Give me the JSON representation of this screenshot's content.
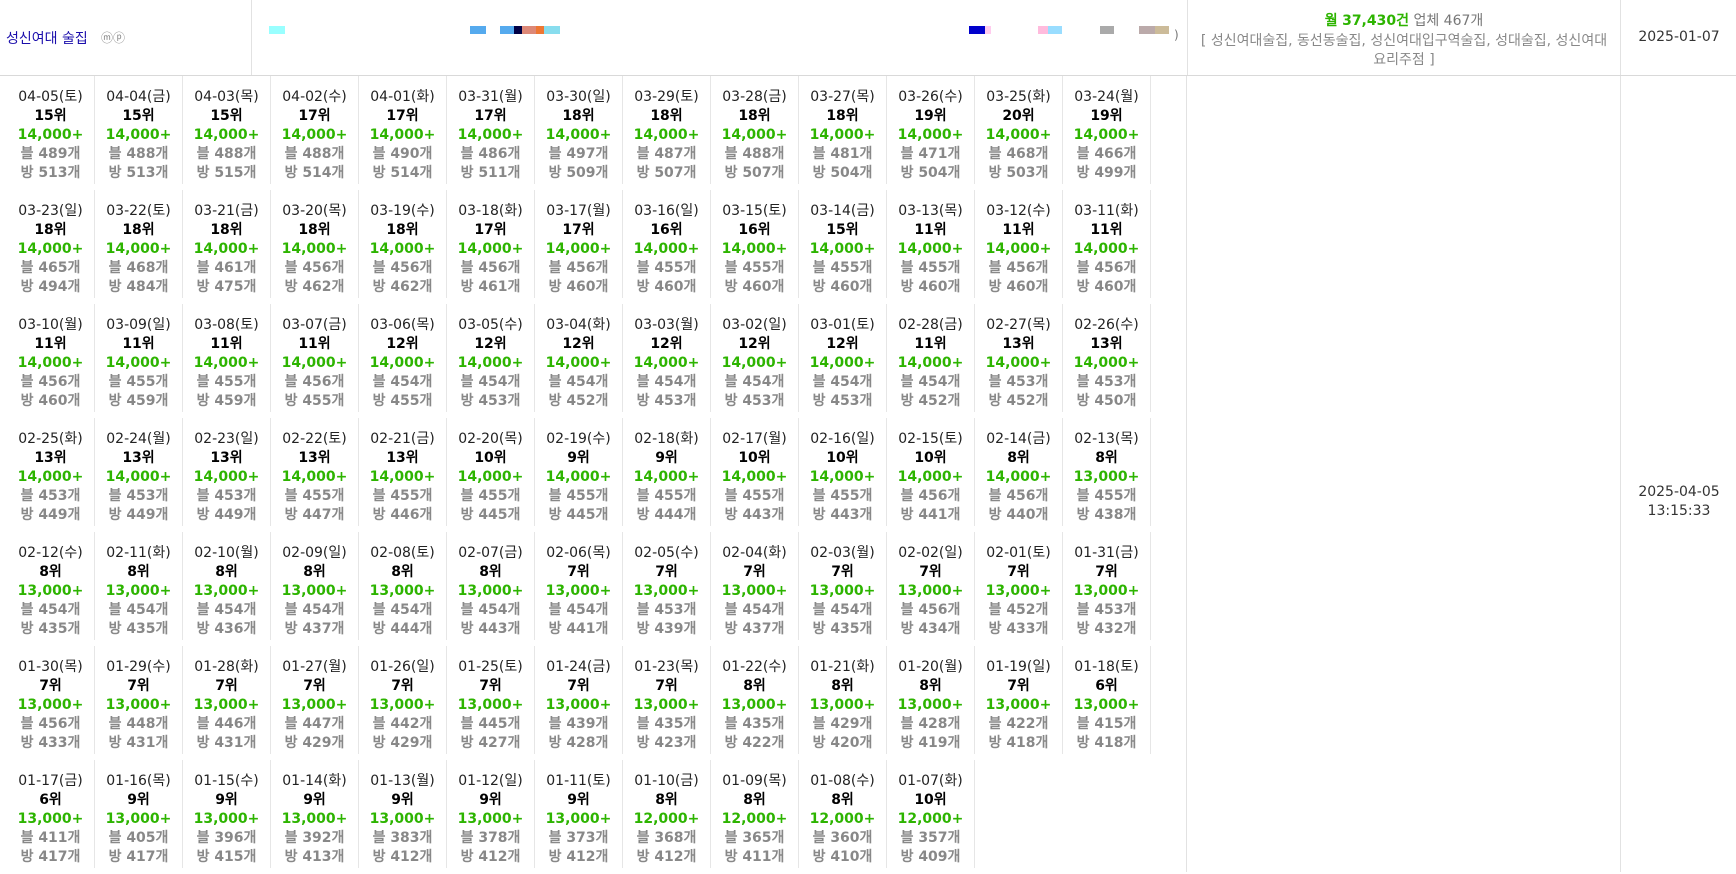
{
  "keyword": {
    "name": "성신여대 술집",
    "icons": "ⓜⓟ"
  },
  "swatches": [
    {
      "color": "#99ffff"
    },
    {
      "color": "#55aaee"
    },
    {
      "color": "#55aaee"
    },
    {
      "color": "#000044"
    },
    {
      "color": "#dd8877"
    },
    {
      "color": "#ee7733"
    },
    {
      "color": "#88ddee"
    },
    {
      "color": "#0000cc"
    },
    {
      "color": "#ffccee"
    },
    {
      "color": "#ffbbdd"
    },
    {
      "color": "#99ddff"
    },
    {
      "color": "#aaaaaa"
    },
    {
      "color": "#bbaaaa"
    },
    {
      "color": "#ccbb99"
    }
  ],
  "strip_paren": ")",
  "stats": {
    "monthly_label": "월",
    "monthly_value": "37,430건",
    "business_label": "업체",
    "business_value": "467개",
    "related_keywords": "[ 성신여대술집, 동선동술집, 성신여대입구역술집, 성대술집, 성신여대요리주점 ]"
  },
  "registered_date": "2025-01-07",
  "updated": {
    "date": "2025-04-05",
    "time": "13:15:33"
  },
  "days": [
    {
      "date": "04-05(토)",
      "rank": "15위",
      "volume": "14,000+",
      "blog": "블 489개",
      "room": "방 513개"
    },
    {
      "date": "04-04(금)",
      "rank": "15위",
      "volume": "14,000+",
      "blog": "블 488개",
      "room": "방 513개"
    },
    {
      "date": "04-03(목)",
      "rank": "15위",
      "volume": "14,000+",
      "blog": "블 488개",
      "room": "방 515개"
    },
    {
      "date": "04-02(수)",
      "rank": "17위",
      "volume": "14,000+",
      "blog": "블 488개",
      "room": "방 514개"
    },
    {
      "date": "04-01(화)",
      "rank": "17위",
      "volume": "14,000+",
      "blog": "블 490개",
      "room": "방 514개"
    },
    {
      "date": "03-31(월)",
      "rank": "17위",
      "volume": "14,000+",
      "blog": "블 486개",
      "room": "방 511개"
    },
    {
      "date": "03-30(일)",
      "rank": "18위",
      "volume": "14,000+",
      "blog": "블 497개",
      "room": "방 509개"
    },
    {
      "date": "03-29(토)",
      "rank": "18위",
      "volume": "14,000+",
      "blog": "블 487개",
      "room": "방 507개"
    },
    {
      "date": "03-28(금)",
      "rank": "18위",
      "volume": "14,000+",
      "blog": "블 488개",
      "room": "방 507개"
    },
    {
      "date": "03-27(목)",
      "rank": "18위",
      "volume": "14,000+",
      "blog": "블 481개",
      "room": "방 504개"
    },
    {
      "date": "03-26(수)",
      "rank": "19위",
      "volume": "14,000+",
      "blog": "블 471개",
      "room": "방 504개"
    },
    {
      "date": "03-25(화)",
      "rank": "20위",
      "volume": "14,000+",
      "blog": "블 468개",
      "room": "방 503개"
    },
    {
      "date": "03-24(월)",
      "rank": "19위",
      "volume": "14,000+",
      "blog": "블 466개",
      "room": "방 499개"
    },
    {
      "date": "03-23(일)",
      "rank": "18위",
      "volume": "14,000+",
      "blog": "블 465개",
      "room": "방 494개"
    },
    {
      "date": "03-22(토)",
      "rank": "18위",
      "volume": "14,000+",
      "blog": "블 468개",
      "room": "방 484개"
    },
    {
      "date": "03-21(금)",
      "rank": "18위",
      "volume": "14,000+",
      "blog": "블 461개",
      "room": "방 475개"
    },
    {
      "date": "03-20(목)",
      "rank": "18위",
      "volume": "14,000+",
      "blog": "블 456개",
      "room": "방 462개"
    },
    {
      "date": "03-19(수)",
      "rank": "18위",
      "volume": "14,000+",
      "blog": "블 456개",
      "room": "방 462개"
    },
    {
      "date": "03-18(화)",
      "rank": "17위",
      "volume": "14,000+",
      "blog": "블 456개",
      "room": "방 461개"
    },
    {
      "date": "03-17(월)",
      "rank": "17위",
      "volume": "14,000+",
      "blog": "블 456개",
      "room": "방 460개"
    },
    {
      "date": "03-16(일)",
      "rank": "16위",
      "volume": "14,000+",
      "blog": "블 455개",
      "room": "방 460개"
    },
    {
      "date": "03-15(토)",
      "rank": "16위",
      "volume": "14,000+",
      "blog": "블 455개",
      "room": "방 460개"
    },
    {
      "date": "03-14(금)",
      "rank": "15위",
      "volume": "14,000+",
      "blog": "블 455개",
      "room": "방 460개"
    },
    {
      "date": "03-13(목)",
      "rank": "11위",
      "volume": "14,000+",
      "blog": "블 455개",
      "room": "방 460개"
    },
    {
      "date": "03-12(수)",
      "rank": "11위",
      "volume": "14,000+",
      "blog": "블 456개",
      "room": "방 460개"
    },
    {
      "date": "03-11(화)",
      "rank": "11위",
      "volume": "14,000+",
      "blog": "블 456개",
      "room": "방 460개"
    },
    {
      "date": "03-10(월)",
      "rank": "11위",
      "volume": "14,000+",
      "blog": "블 456개",
      "room": "방 460개"
    },
    {
      "date": "03-09(일)",
      "rank": "11위",
      "volume": "14,000+",
      "blog": "블 455개",
      "room": "방 459개"
    },
    {
      "date": "03-08(토)",
      "rank": "11위",
      "volume": "14,000+",
      "blog": "블 455개",
      "room": "방 459개"
    },
    {
      "date": "03-07(금)",
      "rank": "11위",
      "volume": "14,000+",
      "blog": "블 456개",
      "room": "방 455개"
    },
    {
      "date": "03-06(목)",
      "rank": "12위",
      "volume": "14,000+",
      "blog": "블 454개",
      "room": "방 455개"
    },
    {
      "date": "03-05(수)",
      "rank": "12위",
      "volume": "14,000+",
      "blog": "블 454개",
      "room": "방 453개"
    },
    {
      "date": "03-04(화)",
      "rank": "12위",
      "volume": "14,000+",
      "blog": "블 454개",
      "room": "방 452개"
    },
    {
      "date": "03-03(월)",
      "rank": "12위",
      "volume": "14,000+",
      "blog": "블 454개",
      "room": "방 453개"
    },
    {
      "date": "03-02(일)",
      "rank": "12위",
      "volume": "14,000+",
      "blog": "블 454개",
      "room": "방 453개"
    },
    {
      "date": "03-01(토)",
      "rank": "12위",
      "volume": "14,000+",
      "blog": "블 454개",
      "room": "방 453개"
    },
    {
      "date": "02-28(금)",
      "rank": "11위",
      "volume": "14,000+",
      "blog": "블 454개",
      "room": "방 452개"
    },
    {
      "date": "02-27(목)",
      "rank": "13위",
      "volume": "14,000+",
      "blog": "블 453개",
      "room": "방 452개"
    },
    {
      "date": "02-26(수)",
      "rank": "13위",
      "volume": "14,000+",
      "blog": "블 453개",
      "room": "방 450개"
    },
    {
      "date": "02-25(화)",
      "rank": "13위",
      "volume": "14,000+",
      "blog": "블 453개",
      "room": "방 449개"
    },
    {
      "date": "02-24(월)",
      "rank": "13위",
      "volume": "14,000+",
      "blog": "블 453개",
      "room": "방 449개"
    },
    {
      "date": "02-23(일)",
      "rank": "13위",
      "volume": "14,000+",
      "blog": "블 453개",
      "room": "방 449개"
    },
    {
      "date": "02-22(토)",
      "rank": "13위",
      "volume": "14,000+",
      "blog": "블 455개",
      "room": "방 447개"
    },
    {
      "date": "02-21(금)",
      "rank": "13위",
      "volume": "14,000+",
      "blog": "블 455개",
      "room": "방 446개"
    },
    {
      "date": "02-20(목)",
      "rank": "10위",
      "volume": "14,000+",
      "blog": "블 455개",
      "room": "방 445개"
    },
    {
      "date": "02-19(수)",
      "rank": "9위",
      "volume": "14,000+",
      "blog": "블 455개",
      "room": "방 445개"
    },
    {
      "date": "02-18(화)",
      "rank": "9위",
      "volume": "14,000+",
      "blog": "블 455개",
      "room": "방 444개"
    },
    {
      "date": "02-17(월)",
      "rank": "10위",
      "volume": "14,000+",
      "blog": "블 455개",
      "room": "방 443개"
    },
    {
      "date": "02-16(일)",
      "rank": "10위",
      "volume": "14,000+",
      "blog": "블 455개",
      "room": "방 443개"
    },
    {
      "date": "02-15(토)",
      "rank": "10위",
      "volume": "14,000+",
      "blog": "블 456개",
      "room": "방 441개"
    },
    {
      "date": "02-14(금)",
      "rank": "8위",
      "volume": "14,000+",
      "blog": "블 456개",
      "room": "방 440개"
    },
    {
      "date": "02-13(목)",
      "rank": "8위",
      "volume": "13,000+",
      "blog": "블 455개",
      "room": "방 438개"
    },
    {
      "date": "02-12(수)",
      "rank": "8위",
      "volume": "13,000+",
      "blog": "블 454개",
      "room": "방 435개"
    },
    {
      "date": "02-11(화)",
      "rank": "8위",
      "volume": "13,000+",
      "blog": "블 454개",
      "room": "방 435개"
    },
    {
      "date": "02-10(월)",
      "rank": "8위",
      "volume": "13,000+",
      "blog": "블 454개",
      "room": "방 436개"
    },
    {
      "date": "02-09(일)",
      "rank": "8위",
      "volume": "13,000+",
      "blog": "블 454개",
      "room": "방 437개"
    },
    {
      "date": "02-08(토)",
      "rank": "8위",
      "volume": "13,000+",
      "blog": "블 454개",
      "room": "방 444개"
    },
    {
      "date": "02-07(금)",
      "rank": "8위",
      "volume": "13,000+",
      "blog": "블 454개",
      "room": "방 443개"
    },
    {
      "date": "02-06(목)",
      "rank": "7위",
      "volume": "13,000+",
      "blog": "블 454개",
      "room": "방 441개"
    },
    {
      "date": "02-05(수)",
      "rank": "7위",
      "volume": "13,000+",
      "blog": "블 453개",
      "room": "방 439개"
    },
    {
      "date": "02-04(화)",
      "rank": "7위",
      "volume": "13,000+",
      "blog": "블 454개",
      "room": "방 437개"
    },
    {
      "date": "02-03(월)",
      "rank": "7위",
      "volume": "13,000+",
      "blog": "블 454개",
      "room": "방 435개"
    },
    {
      "date": "02-02(일)",
      "rank": "7위",
      "volume": "13,000+",
      "blog": "블 456개",
      "room": "방 434개"
    },
    {
      "date": "02-01(토)",
      "rank": "7위",
      "volume": "13,000+",
      "blog": "블 452개",
      "room": "방 433개"
    },
    {
      "date": "01-31(금)",
      "rank": "7위",
      "volume": "13,000+",
      "blog": "블 453개",
      "room": "방 432개"
    },
    {
      "date": "01-30(목)",
      "rank": "7위",
      "volume": "13,000+",
      "blog": "블 456개",
      "room": "방 433개"
    },
    {
      "date": "01-29(수)",
      "rank": "7위",
      "volume": "13,000+",
      "blog": "블 448개",
      "room": "방 431개"
    },
    {
      "date": "01-28(화)",
      "rank": "7위",
      "volume": "13,000+",
      "blog": "블 446개",
      "room": "방 431개"
    },
    {
      "date": "01-27(월)",
      "rank": "7위",
      "volume": "13,000+",
      "blog": "블 447개",
      "room": "방 429개"
    },
    {
      "date": "01-26(일)",
      "rank": "7위",
      "volume": "13,000+",
      "blog": "블 442개",
      "room": "방 429개"
    },
    {
      "date": "01-25(토)",
      "rank": "7위",
      "volume": "13,000+",
      "blog": "블 445개",
      "room": "방 427개"
    },
    {
      "date": "01-24(금)",
      "rank": "7위",
      "volume": "13,000+",
      "blog": "블 439개",
      "room": "방 428개"
    },
    {
      "date": "01-23(목)",
      "rank": "7위",
      "volume": "13,000+",
      "blog": "블 435개",
      "room": "방 423개"
    },
    {
      "date": "01-22(수)",
      "rank": "8위",
      "volume": "13,000+",
      "blog": "블 435개",
      "room": "방 422개"
    },
    {
      "date": "01-21(화)",
      "rank": "8위",
      "volume": "13,000+",
      "blog": "블 429개",
      "room": "방 420개"
    },
    {
      "date": "01-20(월)",
      "rank": "8위",
      "volume": "13,000+",
      "blog": "블 428개",
      "room": "방 419개"
    },
    {
      "date": "01-19(일)",
      "rank": "7위",
      "volume": "13,000+",
      "blog": "블 422개",
      "room": "방 418개"
    },
    {
      "date": "01-18(토)",
      "rank": "6위",
      "volume": "13,000+",
      "blog": "블 415개",
      "room": "방 418개"
    },
    {
      "date": "01-17(금)",
      "rank": "6위",
      "volume": "13,000+",
      "blog": "블 411개",
      "room": "방 417개"
    },
    {
      "date": "01-16(목)",
      "rank": "9위",
      "volume": "13,000+",
      "blog": "블 405개",
      "room": "방 417개"
    },
    {
      "date": "01-15(수)",
      "rank": "9위",
      "volume": "13,000+",
      "blog": "블 396개",
      "room": "방 415개"
    },
    {
      "date": "01-14(화)",
      "rank": "9위",
      "volume": "13,000+",
      "blog": "블 392개",
      "room": "방 413개"
    },
    {
      "date": "01-13(월)",
      "rank": "9위",
      "volume": "13,000+",
      "blog": "블 383개",
      "room": "방 412개"
    },
    {
      "date": "01-12(일)",
      "rank": "9위",
      "volume": "13,000+",
      "blog": "블 378개",
      "room": "방 412개"
    },
    {
      "date": "01-11(토)",
      "rank": "9위",
      "volume": "13,000+",
      "blog": "블 373개",
      "room": "방 412개"
    },
    {
      "date": "01-10(금)",
      "rank": "8위",
      "volume": "12,000+",
      "blog": "블 368개",
      "room": "방 412개"
    },
    {
      "date": "01-09(목)",
      "rank": "8위",
      "volume": "12,000+",
      "blog": "블 365개",
      "room": "방 411개"
    },
    {
      "date": "01-08(수)",
      "rank": "8위",
      "volume": "12,000+",
      "blog": "블 360개",
      "room": "방 410개"
    },
    {
      "date": "01-07(화)",
      "rank": "10위",
      "volume": "12,000+",
      "blog": "블 357개",
      "room": "방 409개"
    }
  ]
}
